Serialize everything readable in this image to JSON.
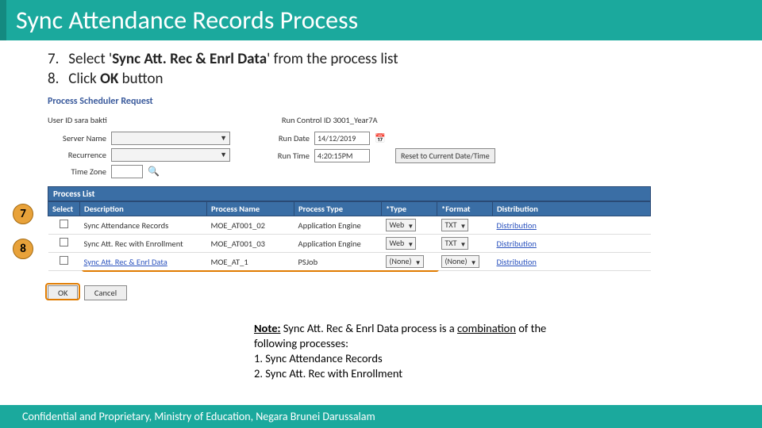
{
  "title": "Sync Attendance Records Process",
  "steps": [
    {
      "num": "7.",
      "prefix": "Select '",
      "bold": "Sync Att. Rec & Enrl Data",
      "suffix": "' from the process list"
    },
    {
      "num": "8.",
      "prefix": "Click ",
      "bold": "OK",
      "suffix": " button"
    }
  ],
  "screenshot": {
    "heading": "Process Scheduler Request",
    "user_id_label": "User ID",
    "user_id_value": "sara bakti",
    "run_control_label": "Run Control ID",
    "run_control_value": "3001_Year7A",
    "server_name_label": "Server Name",
    "recurrence_label": "Recurrence",
    "time_zone_label": "Time Zone",
    "run_date_label": "Run Date",
    "run_date_value": "14/12/2019",
    "run_time_label": "Run Time",
    "run_time_value": "4:20:15PM",
    "reset_button": "Reset to Current Date/Time",
    "process_list_label": "Process List",
    "columns": {
      "select": "Select",
      "desc": "Description",
      "pname": "Process Name",
      "ptype": "Process Type",
      "type": "*Type",
      "format": "*Format",
      "dist": "Distribution"
    },
    "rows": [
      {
        "desc": "Sync Attendance Records",
        "pname": "MOE_AT001_02",
        "ptype": "Application Engine",
        "type": "Web",
        "format": "TXT",
        "dist": "Distribution"
      },
      {
        "desc": "Sync Att. Rec with Enrollment",
        "pname": "MOE_AT001_03",
        "ptype": "Application Engine",
        "type": "Web",
        "format": "TXT",
        "dist": "Distribution"
      },
      {
        "desc": "Sync Att. Rec & Enrl Data",
        "pname": "MOE_AT_1",
        "ptype": "PSJob",
        "type": "(None)",
        "format": "(None)",
        "dist": "Distribution"
      }
    ],
    "ok": "OK",
    "cancel": "Cancel"
  },
  "callouts": {
    "seven": "7",
    "eight": "8"
  },
  "note": {
    "lead": "Note:",
    "l1a": " Sync Att. Rec & Enrl Data process is a ",
    "l1b": "combination",
    "l1c": " of the following processes:",
    "n1": "1.   Sync Attendance Records",
    "n2": "2.   Sync Att. Rec with Enrollment"
  },
  "footer": "Confidential and Proprietary, Ministry of Education, Negara Brunei Darussalam"
}
